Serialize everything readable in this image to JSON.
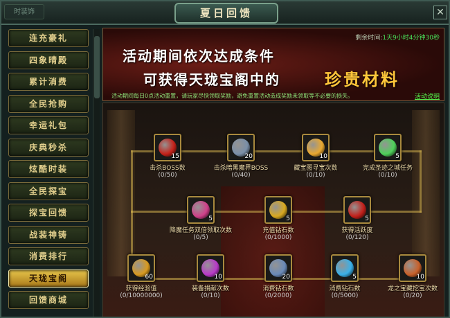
{
  "window": {
    "title": "夏日回馈",
    "corner_label": "时装饰"
  },
  "sidebar": {
    "items": [
      {
        "label": "连充豪礼",
        "active": false
      },
      {
        "label": "四象晴殿",
        "active": false
      },
      {
        "label": "累计消费",
        "active": false
      },
      {
        "label": "全民抢购",
        "active": false
      },
      {
        "label": "幸运礼包",
        "active": false
      },
      {
        "label": "庆典秒杀",
        "active": false
      },
      {
        "label": "炫酷时装",
        "active": false
      },
      {
        "label": "全民探宝",
        "active": false
      },
      {
        "label": "探宝回馈",
        "active": false
      },
      {
        "label": "战装神铸",
        "active": false
      },
      {
        "label": "消费排行",
        "active": false
      },
      {
        "label": "天珑宝阁",
        "active": true
      },
      {
        "label": "回馈商城",
        "active": false
      }
    ]
  },
  "banner": {
    "line1": "活动期间依次达成条件",
    "line2": "可获得天珑宝阁中的",
    "highlight": "珍贵材料",
    "timer_label": "剩余时间:",
    "timer_value": "1天9小时4分钟30秒",
    "notice": "活动期间每日0点活动重置，请玩家尽快领取奖励，避免重置活动造成奖励未领取等不必要的损失。",
    "help": "活动说明"
  },
  "tasks": [
    {
      "label": "击杀BOSS数",
      "progress": "(0/50)",
      "count": "15",
      "icon": "gold-chest-icon",
      "color": "#c4221a"
    },
    {
      "label": "击杀暗黑魔界BOSS",
      "progress": "(0/40)",
      "count": "20",
      "icon": "silver-ore-icon",
      "color": "#7a8fa8"
    },
    {
      "label": "藏宝图寻宝次数",
      "progress": "(0/10)",
      "count": "10",
      "icon": "gold-rings-icon",
      "color": "#e8a830"
    },
    {
      "label": "完成圣迹之城任务",
      "progress": "(0/10)",
      "count": "5",
      "icon": "green-crystal-icon",
      "color": "#4ed05a"
    },
    {
      "label": "降魔任务双倍领取次数",
      "progress": "(0/5)",
      "count": "5",
      "icon": "pink-crystal-icon",
      "color": "#d0408a"
    },
    {
      "label": "充值钻石数",
      "progress": "(0/1000)",
      "count": "5",
      "icon": "gold-amulet-icon",
      "color": "#d8a820"
    },
    {
      "label": "获得活跃度",
      "progress": "(0/120)",
      "count": "5",
      "icon": "red-gem-icon",
      "color": "#c2201a"
    },
    {
      "label": "获得经验值",
      "progress": "(0/10000000)",
      "count": "60",
      "icon": "gold-token-icon",
      "color": "#d89a20"
    },
    {
      "label": "装备捐献次数",
      "progress": "(0/10)",
      "count": "10",
      "icon": "purple-orb-icon",
      "color": "#b83ac8"
    },
    {
      "label": "消费钻石数",
      "progress": "(0/2000)",
      "count": "20",
      "icon": "blue-ore-icon",
      "color": "#6a8ab8"
    },
    {
      "label": "消费钻石数",
      "progress": "(0/5000)",
      "count": "5",
      "icon": "blue-crystal-icon",
      "color": "#3ab0e8"
    },
    {
      "label": "龙之宝藏挖宝次数",
      "progress": "(0/20)",
      "count": "10",
      "icon": "treasure-bag-icon",
      "color": "#c8602a"
    }
  ]
}
